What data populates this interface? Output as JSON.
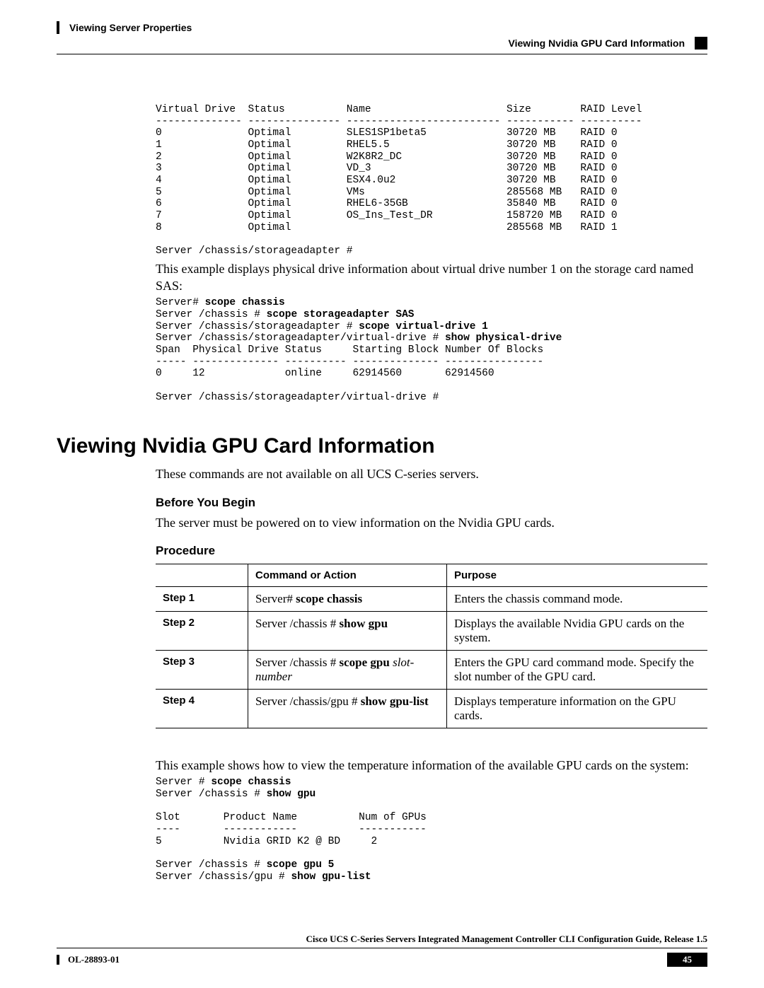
{
  "header": {
    "left": "Viewing Server Properties",
    "right": "Viewing Nvidia GPU Card Information"
  },
  "vd_table": "Virtual Drive  Status          Name                      Size        RAID Level\n-------------- --------------- ------------------------- ----------- ----------\n0              Optimal         SLES1SP1beta5             30720 MB    RAID 0\n1              Optimal         RHEL5.5                   30720 MB    RAID 0\n2              Optimal         W2K8R2_DC                 30720 MB    RAID 0\n3              Optimal         VD_3                      30720 MB    RAID 0\n4              Optimal         ESX4.0u2                  30720 MB    RAID 0\n5              Optimal         VMs                       285568 MB   RAID 0\n6              Optimal         RHEL6-35GB                35840 MB    RAID 0\n7              Optimal         OS_Ins_Test_DR            158720 MB   RAID 0\n8              Optimal                                   285568 MB   RAID 1\n\nServer /chassis/storageadapter #",
  "para_vd_intro": "This example displays physical drive information about virtual drive number 1 on the storage card named SAS:",
  "cmd_block1": {
    "p0": "Server# ",
    "b0": "scope chassis",
    "p1": "\nServer /chassis # ",
    "b1": "scope storageadapter SAS",
    "p2": "\nServer /chassis/storageadapter # ",
    "b2": "scope virtual-drive 1",
    "p3": "\nServer /chassis/storageadapter/virtual-drive # ",
    "b3": "show physical-drive",
    "p4": "\nSpan  Physical Drive Status     Starting Block Number Of Blocks\n----- -------------- ---------- -------------- ----------------\n0     12             online     62914560       62914560\n\nServer /chassis/storageadapter/virtual-drive #"
  },
  "section_title": "Viewing Nvidia GPU Card Information",
  "intro_gpu": "These commands are not available on all UCS C-series servers.",
  "before_heading": "Before You Begin",
  "before_text": "The server must be powered on to view information on the Nvidia GPU cards.",
  "procedure_heading": "Procedure",
  "table": {
    "h_cmd": "Command or Action",
    "h_purpose": "Purpose",
    "r1": {
      "step": "Step 1",
      "cmd_pre": "Server# ",
      "cmd_bold": "scope chassis",
      "purpose": "Enters the chassis command mode."
    },
    "r2": {
      "step": "Step 2",
      "cmd_pre": "Server /chassis # ",
      "cmd_bold": "show gpu",
      "purpose": "Displays the available Nvidia GPU cards on the system."
    },
    "r3": {
      "step": "Step 3",
      "cmd_pre": "Server /chassis # ",
      "cmd_bold": "scope gpu",
      "cmd_italic": " slot-number",
      "purpose": "Enters the GPU card command mode. Specify the slot number of the GPU card."
    },
    "r4": {
      "step": "Step 4",
      "cmd_pre": "Server /chassis/gpu # ",
      "cmd_bold": "show gpu-list",
      "purpose": "Displays temperature information on the GPU cards."
    }
  },
  "example_para": "This example shows how to view the temperature information of the available GPU cards on the system:",
  "cmd_block2": {
    "p0": "Server # ",
    "b0": "scope chassis",
    "p1": "\nServer /chassis # ",
    "b1": "show gpu",
    "p2": "\n\nSlot       Product Name          Num of GPUs\n----       ------------          -----------\n5          Nvidia GRID K2 @ BD     2\n\nServer /chassis # ",
    "b2": "scope gpu 5",
    "p3": "\nServer /chassis/gpu # ",
    "b3": "show gpu-list"
  },
  "footer": {
    "title": "Cisco UCS C-Series Servers Integrated Management Controller CLI Configuration Guide, Release 1.5",
    "doc_id": "OL-28893-01",
    "page": "45"
  }
}
